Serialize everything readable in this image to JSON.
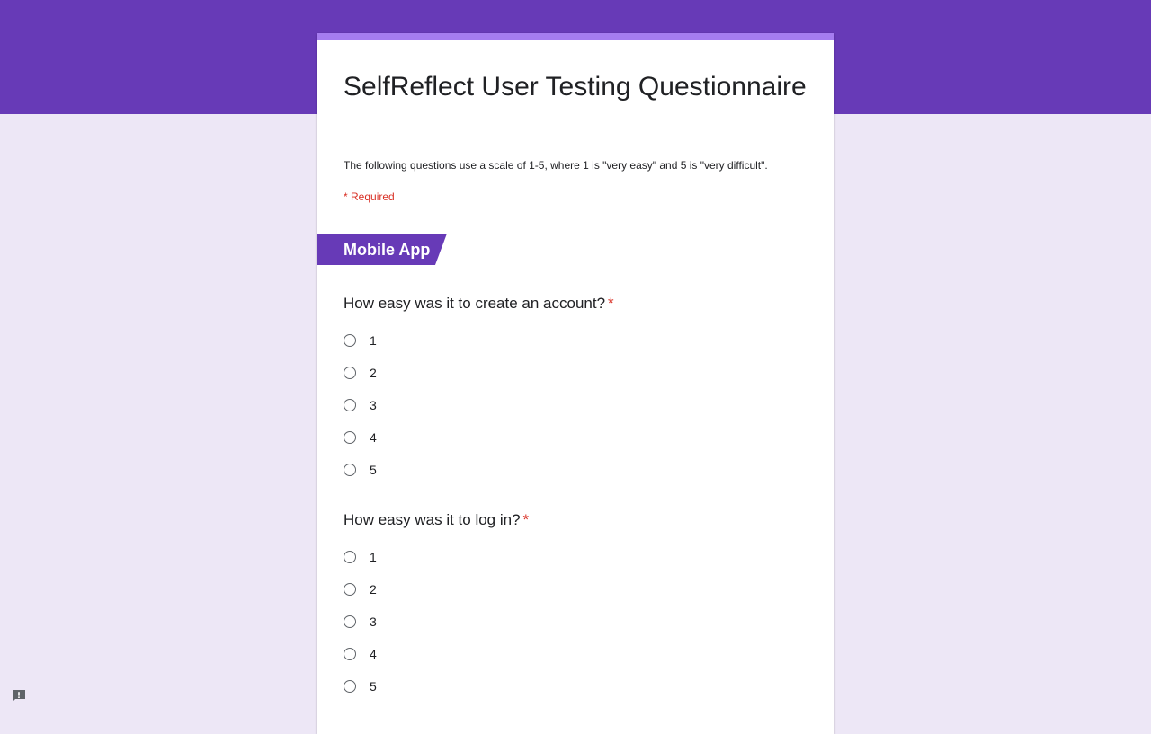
{
  "form": {
    "title": "SelfReflect User Testing Questionnaire",
    "description": "The following questions use a scale of 1-5, where 1 is \"very easy\" and 5 is \"very difficult\".",
    "required_note": "* Required"
  },
  "section": {
    "title": "Mobile App"
  },
  "questions": [
    {
      "title": "How easy was it to create an account?",
      "required_mark": "*",
      "options": [
        "1",
        "2",
        "3",
        "4",
        "5"
      ]
    },
    {
      "title": "How easy was it to log in?",
      "required_mark": "*",
      "options": [
        "1",
        "2",
        "3",
        "4",
        "5"
      ]
    }
  ],
  "colors": {
    "brand": "#673ab7",
    "accent": "#a57cf0",
    "page_background": "#ede7f6",
    "required": "#d93025"
  },
  "icons": {
    "feedback": "report-feedback-icon"
  }
}
